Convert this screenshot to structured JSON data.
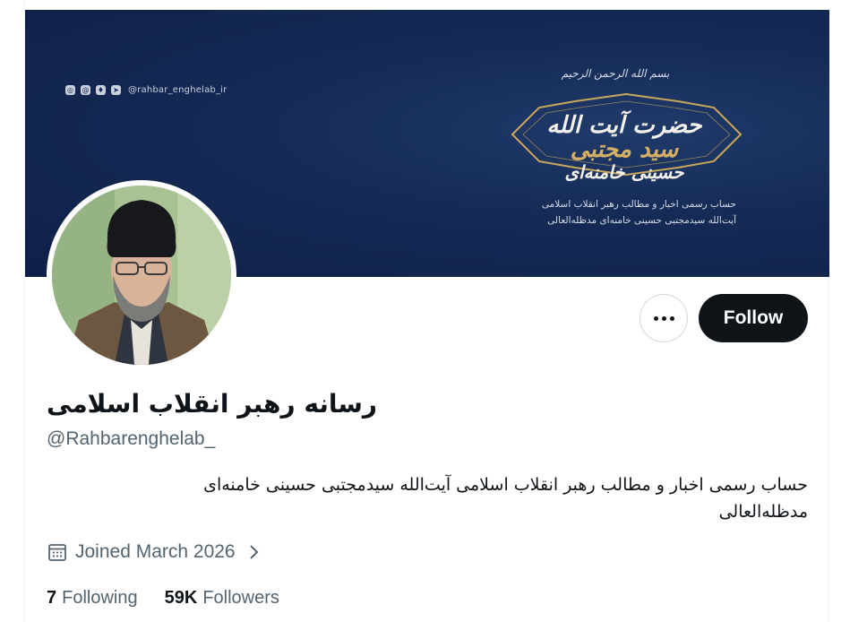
{
  "banner": {
    "social_handle": "@rahbar_enghelab_ir",
    "social_icons": [
      "instagram-icon",
      "threads-icon",
      "shield-icon",
      "telegram-icon"
    ],
    "basmala": "بسم الله الرحمن الرحیم",
    "emblem_line1": "حضرت آیت الله",
    "emblem_line2": "سید مجتبی",
    "emblem_line3": "حسینی خامنه‌ای",
    "caption_line1": "حساب رسمی اخبار و مطالب رهبر انقلاب اسلامی",
    "caption_line2": "آیت‌الله سیدمجتبی حسینی خامنه‌ای مدظله‌العالی",
    "colors": {
      "navy": "#142a55",
      "gold": "#d4b064"
    }
  },
  "actions": {
    "more_icon": "more-horizontal-icon",
    "follow_label": "Follow"
  },
  "profile": {
    "display_name": "رسانه رهبر انقلاب اسلامی",
    "handle": "@Rahbarenghelab_",
    "bio": "حساب رسمی اخبار و مطالب رهبر انقلاب اسلامی آیت‌الله سیدمجتبی حسینی خامنه‌ای مدظله‌العالی",
    "joined": "Joined March 2026",
    "following_count": "7",
    "following_label": "Following",
    "followers_count": "59K",
    "followers_label": "Followers"
  }
}
